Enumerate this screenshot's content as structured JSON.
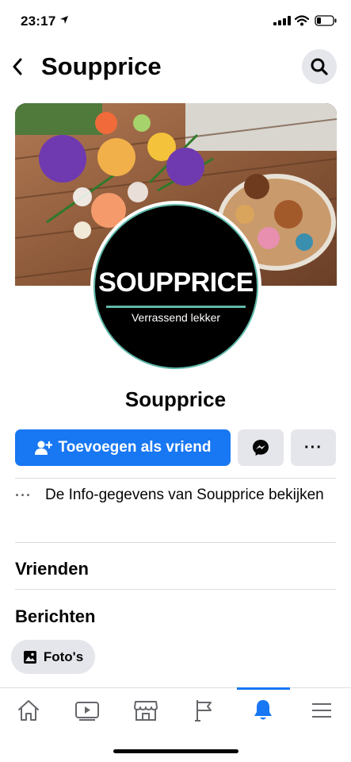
{
  "status_bar": {
    "time": "23:17"
  },
  "header": {
    "title": "Soupprice"
  },
  "profile": {
    "name": "Soupprice",
    "logo_text": "SOUPPRICE",
    "logo_tagline": "Verrassend lekker"
  },
  "actions": {
    "add_friend_label": "Toevoegen als vriend",
    "more_label": "···"
  },
  "info": {
    "dots": "···",
    "text": "De Info-gegevens van Soupprice bekijken"
  },
  "sections": {
    "friends": "Vrienden",
    "posts": "Berichten"
  },
  "photos_chip": {
    "label": "Foto's"
  },
  "tabs": [
    {
      "name": "home-icon"
    },
    {
      "name": "video-icon"
    },
    {
      "name": "marketplace-icon"
    },
    {
      "name": "pages-flag-icon"
    },
    {
      "name": "notifications-bell-icon",
      "active": true
    },
    {
      "name": "menu-icon"
    }
  ],
  "colors": {
    "accent": "#1877f2",
    "button_gray": "#e4e6eb",
    "brand_teal": "#5fb8a8"
  }
}
